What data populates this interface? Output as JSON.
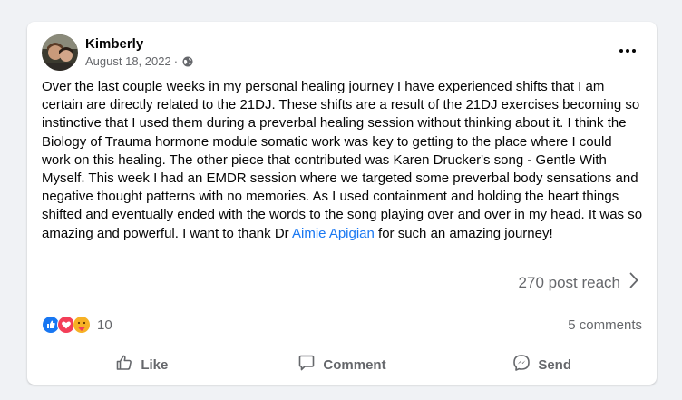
{
  "post": {
    "author": "Kimberly",
    "date": "August 18, 2022",
    "separator": "·",
    "privacy_icon": "globe-icon",
    "body_text": "Over the last couple weeks in my personal healing journey I have experienced shifts that I am certain are directly related to the 21DJ. These shifts are a result of the 21DJ exercises becoming so instinctive that I used them during a preverbal healing session without thinking about it. I think the Biology of Trauma hormone module somatic work was key to getting to the place where I could work on this healing. The other piece that contributed was Karen Drucker's song - Gentle With Myself. This week I had an EMDR session where we targeted some preverbal body sensations and negative thought patterns with no memories. As I used containment and holding the heart things shifted and eventually ended with the words to the song playing over and over in my head. It was so amazing and powerful. I want to thank Dr ",
    "mention": "Aimie Apigian",
    "body_text_end": " for such an amazing journey!",
    "reach": "270 post reach",
    "reaction_count": "10",
    "comments": "5 comments"
  },
  "actions": {
    "like": "Like",
    "comment": "Comment",
    "send": "Send"
  },
  "colors": {
    "link": "#1877f2",
    "secondary_text": "#65676b",
    "like_blue": "#1877f2",
    "love_red": "#f33e58",
    "care_yellow": "#f7b125"
  }
}
